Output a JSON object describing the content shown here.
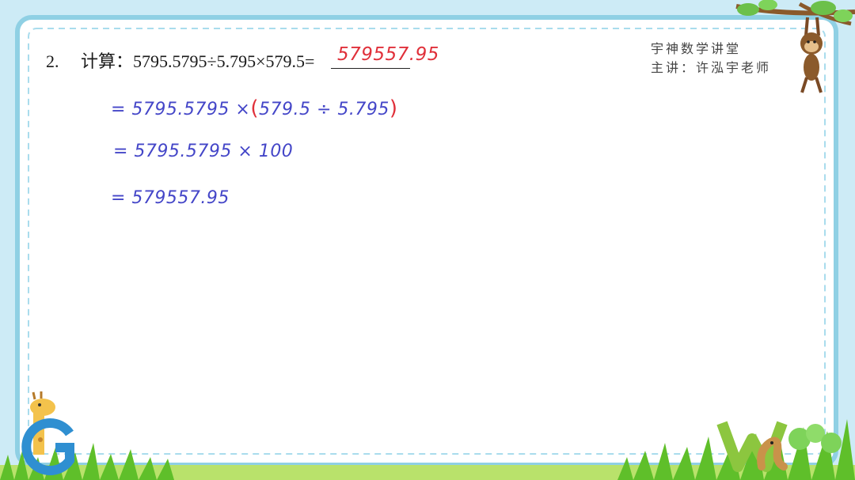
{
  "problem": {
    "number": "2.",
    "label": "计算：",
    "expression": "5795.5795÷5.795×579.5=",
    "answer": "579557.95"
  },
  "branding": {
    "line1": "宇神数学讲堂",
    "line2": "主讲：许泓宇老师"
  },
  "solution": {
    "step1": {
      "prefix": "= 5795.5795 ×",
      "open_paren": "(",
      "inner": "579.5 ÷ 5.795",
      "close_paren": ")"
    },
    "step2": "= 5795.5795 × 100",
    "step3": "= 579557.95"
  },
  "colors": {
    "background": "#cdebf6",
    "border": "#8fd0e4",
    "handwriting_blue": "#4446c8",
    "handwriting_red": "#e0303a",
    "grass": "#5fbf2a"
  },
  "icons": [
    "monkey-icon",
    "giraffe-icon",
    "letter-g-icon",
    "letter-w-icon",
    "worm-icon",
    "grass-icon",
    "tree-branch-icon"
  ]
}
